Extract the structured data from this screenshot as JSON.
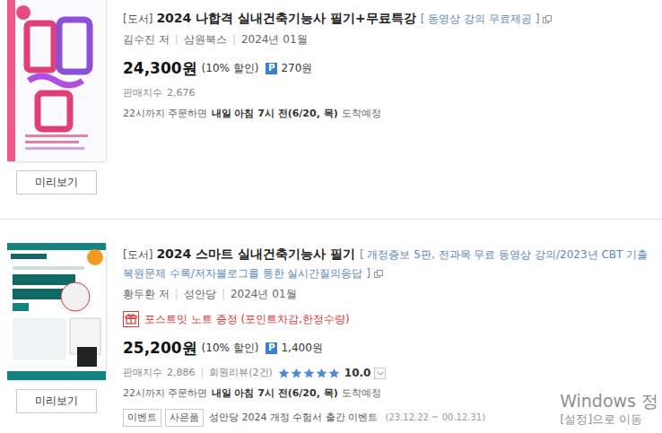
{
  "separator": "|",
  "products": [
    {
      "kind": "pink",
      "category": "[도서]",
      "title": "2024 나합격 실내건축기능사 필기+무료특강",
      "subtitle": "[ 동영상 강의 무료제공 ]",
      "author": "김수진 저",
      "publisher": "삼원북스",
      "date": "2024년 01월",
      "price": "24,300원",
      "discount": "(10% 할인)",
      "point_badge": "P",
      "points": "270원",
      "sales_label": "판매지수",
      "sales": "2,676",
      "delivery": {
        "before": "22시까지 주문하면",
        "emphasis": "내일 아침 7시 전(6/20, 목)",
        "after": "도착예정"
      },
      "preview": "미리보기"
    },
    {
      "kind": "teal",
      "category": "[도서]",
      "title": "2024 스마트 실내건축기능사 필기",
      "subtitle": "[ 개정증보 5판, 전과목 무료 동영상 강의/2023년 CBT 기출 복원문제 수록/저자블로그를 통한 실시간질의응답 ]",
      "author": "황두환 저",
      "publisher": "성안당",
      "date": "2024년 01월",
      "gift": "포스트잇 노트 증정 (포인트차감,한정수량)",
      "price": "25,200원",
      "discount": "(10% 할인)",
      "point_badge": "P",
      "points": "1,400원",
      "sales_label": "판매지수",
      "sales": "2,886",
      "review": {
        "label": "회원리뷰(2건)",
        "stars": 5,
        "score": "10.0"
      },
      "delivery": {
        "before": "22시까지 주문하면",
        "emphasis": "내일 아침 7시 전(6/20, 목)",
        "after": "도착예정"
      },
      "tags": [
        {
          "label": "이벤트"
        },
        {
          "label": "사은품"
        }
      ],
      "event": {
        "title": "성안당 2024 개정 수험서 출간 이벤트",
        "period": "(23.12.22 ~ 00.12.31)"
      },
      "preview": "미리보기"
    }
  ],
  "watermark": {
    "line1": "Windows 정",
    "line2": "[설정]으로 이동"
  }
}
